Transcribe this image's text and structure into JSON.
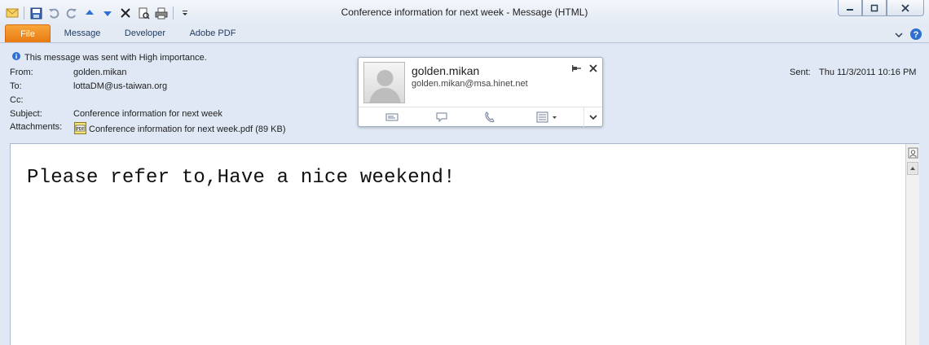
{
  "window": {
    "title": "Conference information for next week  -  Message (HTML)"
  },
  "qat_icons": [
    "envelope-icon",
    "save-icon",
    "undo-icon",
    "redo-icon",
    "up-arrow-icon",
    "down-arrow-icon",
    "delete-icon",
    "print-preview-icon",
    "print-icon",
    "customize-dropdown-icon"
  ],
  "tabs": [
    {
      "label": "File"
    },
    {
      "label": "Message"
    },
    {
      "label": "Developer"
    },
    {
      "label": "Adobe PDF"
    }
  ],
  "header": {
    "importance": "This message was sent with High importance.",
    "from_label": "From:",
    "from": "golden.mikan",
    "to_label": "To:",
    "to": "lottaDM@us-taiwan.org",
    "cc_label": "Cc:",
    "cc": "",
    "subject_label": "Subject:",
    "subject": "Conference information for next week",
    "attachments_label": "Attachments:",
    "attachment": "Conference information for next week.pdf (89 KB)",
    "sent_label": "Sent:",
    "sent": "Thu 11/3/2011 10:16 PM"
  },
  "contact_card": {
    "name": "golden.mikan",
    "email": "golden.mikan@msa.hinet.net"
  },
  "body": {
    "text": "Please refer to,Have a nice weekend!"
  },
  "colors": {
    "file_tab": "#e87a12",
    "header_bg": "#dfe8f4",
    "accent": "#3168b5"
  }
}
